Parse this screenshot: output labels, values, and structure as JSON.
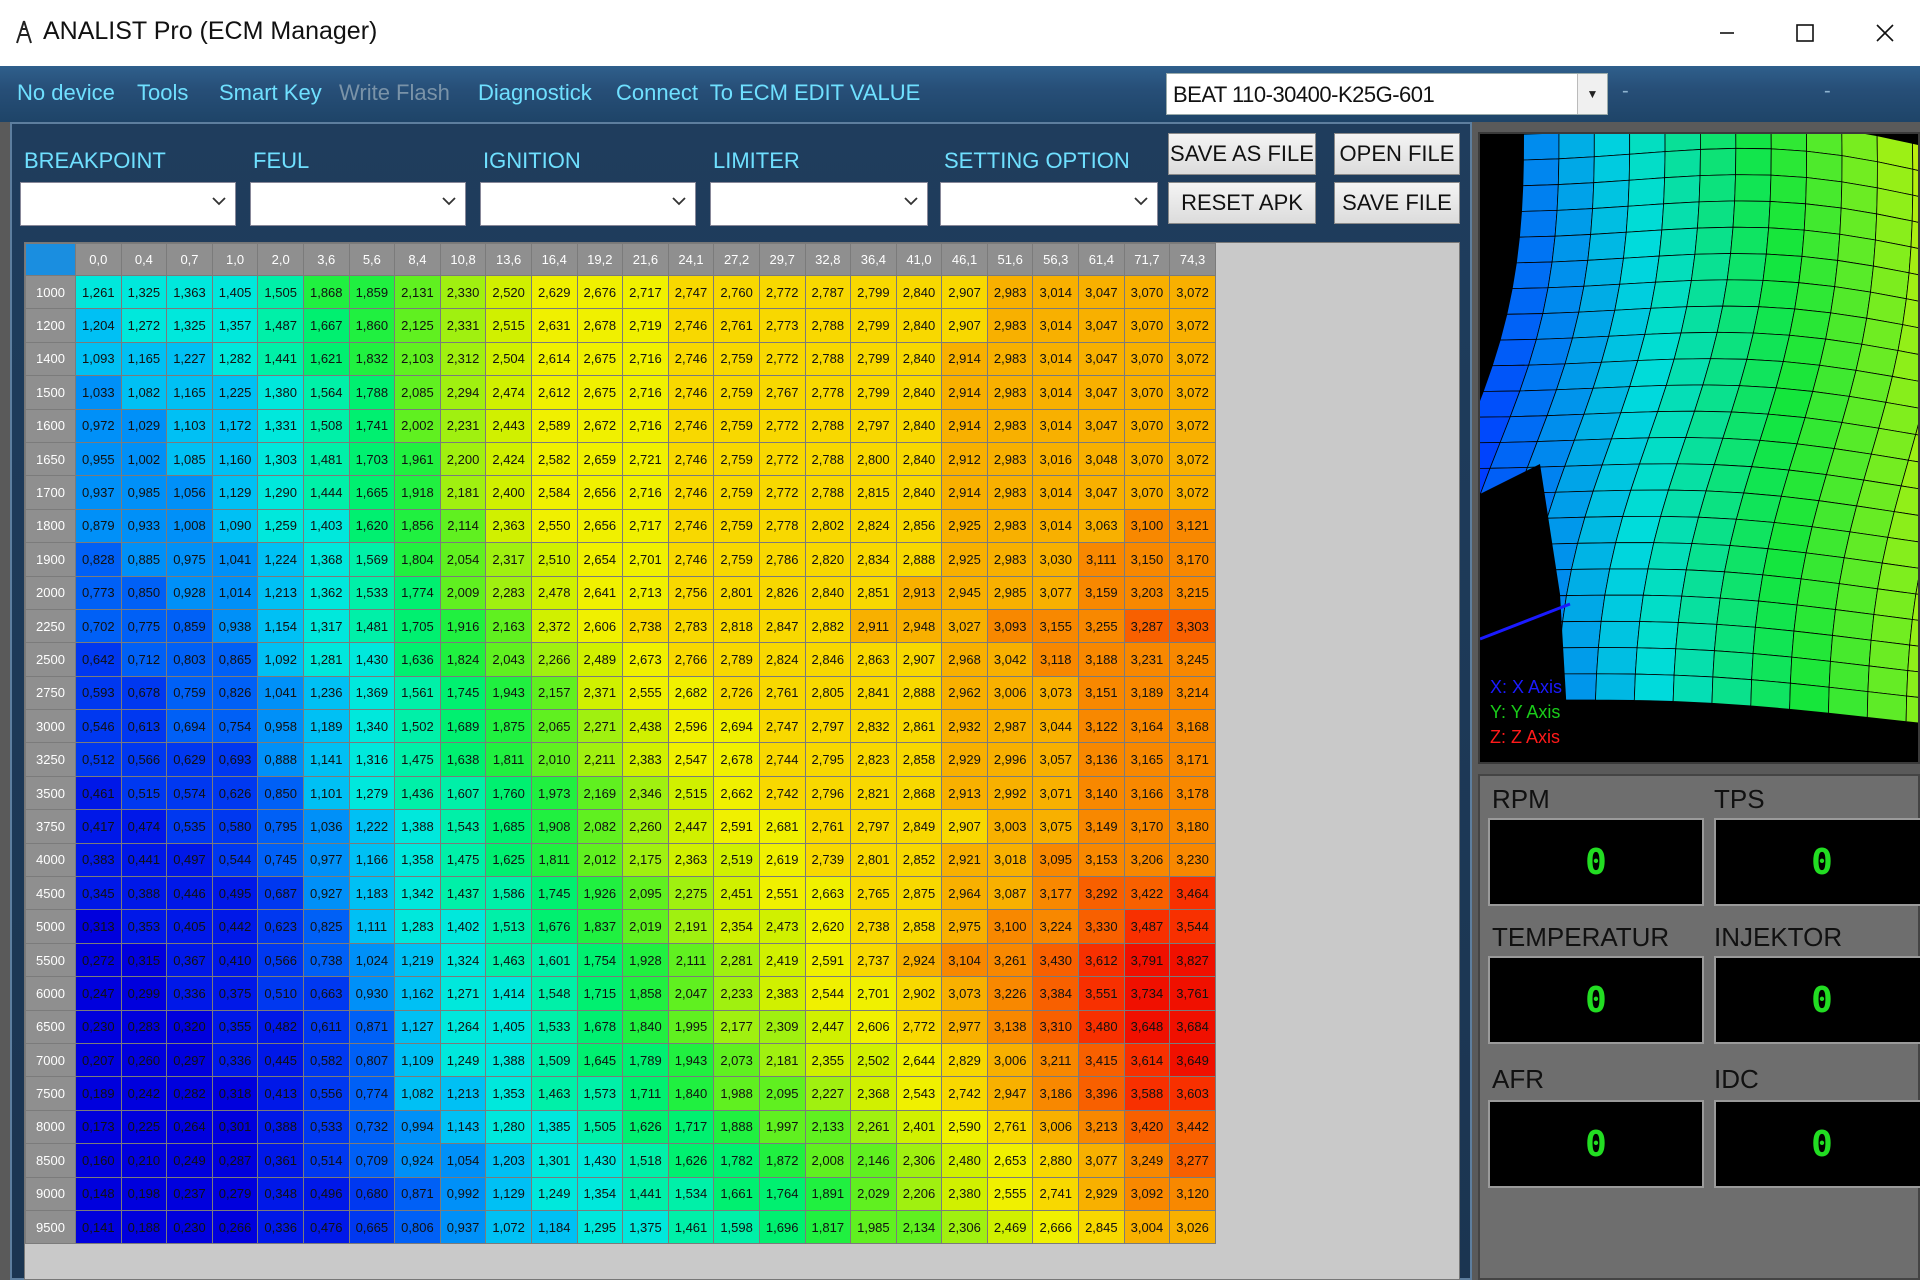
{
  "window": {
    "icon": "app-icon",
    "title": "ANALIST Pro (ECM Manager)"
  },
  "menu": {
    "items": [
      "No device",
      "Tools",
      "Smart Key",
      "Write Flash",
      "Diagnostick",
      "Connect  To ECM",
      "EDIT VALUE"
    ],
    "disabled": [
      "Write Flash"
    ],
    "device_select": "BEAT 110-30400-K25G-601",
    "dash1": "-",
    "dash2": "-"
  },
  "sections": [
    "BREAKPOINT",
    "FEUL",
    "IGNITION",
    "LIMITER",
    "SETTING OPTION"
  ],
  "buttons": {
    "save_as_file": "SAVE AS FILE",
    "open_file": "OPEN FILE",
    "reset_apk": "RESET APK",
    "save_file": "SAVE FILE"
  },
  "colors": {
    "menu_text": "#6fe0ff",
    "panel_bg": "#1f3d5d",
    "gauge_value": "#22dd22"
  },
  "table": {
    "columns": [
      "0,0",
      "0,4",
      "0,7",
      "1,0",
      "2,0",
      "3,6",
      "5,6",
      "8,4",
      "10,8",
      "13,6",
      "16,4",
      "19,2",
      "21,6",
      "24,1",
      "27,2",
      "29,7",
      "32,8",
      "36,4",
      "41,0",
      "46,1",
      "51,6",
      "56,3",
      "61,4",
      "71,7",
      "74,3"
    ],
    "rows": [
      {
        "rpm": "1000",
        "v": [
          "1,261",
          "1,325",
          "1,363",
          "1,405",
          "1,505",
          "1,868",
          "1,859",
          "2,131",
          "2,330",
          "2,520",
          "2,629",
          "2,676",
          "2,717",
          "2,747",
          "2,760",
          "2,772",
          "2,787",
          "2,799",
          "2,840",
          "2,907",
          "2,983",
          "3,014",
          "3,047",
          "3,070",
          "3,072"
        ]
      },
      {
        "rpm": "1200",
        "v": [
          "1,204",
          "1,272",
          "1,325",
          "1,357",
          "1,487",
          "1,667",
          "1,860",
          "2,125",
          "2,331",
          "2,515",
          "2,631",
          "2,678",
          "2,719",
          "2,746",
          "2,761",
          "2,773",
          "2,788",
          "2,799",
          "2,840",
          "2,907",
          "2,983",
          "3,014",
          "3,047",
          "3,070",
          "3,072"
        ]
      },
      {
        "rpm": "1400",
        "v": [
          "1,093",
          "1,165",
          "1,227",
          "1,282",
          "1,441",
          "1,621",
          "1,832",
          "2,103",
          "2,312",
          "2,504",
          "2,614",
          "2,675",
          "2,716",
          "2,746",
          "2,759",
          "2,772",
          "2,788",
          "2,799",
          "2,840",
          "2,914",
          "2,983",
          "3,014",
          "3,047",
          "3,070",
          "3,072"
        ]
      },
      {
        "rpm": "1500",
        "v": [
          "1,033",
          "1,082",
          "1,165",
          "1,225",
          "1,380",
          "1,564",
          "1,788",
          "2,085",
          "2,294",
          "2,474",
          "2,612",
          "2,675",
          "2,716",
          "2,746",
          "2,759",
          "2,767",
          "2,778",
          "2,799",
          "2,840",
          "2,914",
          "2,983",
          "3,014",
          "3,047",
          "3,070",
          "3,072"
        ]
      },
      {
        "rpm": "1600",
        "v": [
          "0,972",
          "1,029",
          "1,103",
          "1,172",
          "1,331",
          "1,508",
          "1,741",
          "2,002",
          "2,231",
          "2,443",
          "2,589",
          "2,672",
          "2,716",
          "2,746",
          "2,759",
          "2,772",
          "2,788",
          "2,797",
          "2,840",
          "2,914",
          "2,983",
          "3,014",
          "3,047",
          "3,070",
          "3,072"
        ]
      },
      {
        "rpm": "1650",
        "v": [
          "0,955",
          "1,002",
          "1,085",
          "1,160",
          "1,303",
          "1,481",
          "1,703",
          "1,961",
          "2,200",
          "2,424",
          "2,582",
          "2,659",
          "2,721",
          "2,746",
          "2,759",
          "2,772",
          "2,788",
          "2,800",
          "2,840",
          "2,912",
          "2,983",
          "3,016",
          "3,048",
          "3,070",
          "3,072"
        ]
      },
      {
        "rpm": "1700",
        "v": [
          "0,937",
          "0,985",
          "1,056",
          "1,129",
          "1,290",
          "1,444",
          "1,665",
          "1,918",
          "2,181",
          "2,400",
          "2,584",
          "2,656",
          "2,716",
          "2,746",
          "2,759",
          "2,772",
          "2,788",
          "2,815",
          "2,840",
          "2,914",
          "2,983",
          "3,014",
          "3,047",
          "3,070",
          "3,072"
        ]
      },
      {
        "rpm": "1800",
        "v": [
          "0,879",
          "0,933",
          "1,008",
          "1,090",
          "1,259",
          "1,403",
          "1,620",
          "1,856",
          "2,114",
          "2,363",
          "2,550",
          "2,656",
          "2,717",
          "2,746",
          "2,759",
          "2,778",
          "2,802",
          "2,824",
          "2,856",
          "2,925",
          "2,983",
          "3,014",
          "3,063",
          "3,100",
          "3,121"
        ]
      },
      {
        "rpm": "1900",
        "v": [
          "0,828",
          "0,885",
          "0,975",
          "1,041",
          "1,224",
          "1,368",
          "1,569",
          "1,804",
          "2,054",
          "2,317",
          "2,510",
          "2,654",
          "2,701",
          "2,746",
          "2,759",
          "2,786",
          "2,820",
          "2,834",
          "2,888",
          "2,925",
          "2,983",
          "3,030",
          "3,111",
          "3,150",
          "3,170"
        ]
      },
      {
        "rpm": "2000",
        "v": [
          "0,773",
          "0,850",
          "0,928",
          "1,014",
          "1,213",
          "1,362",
          "1,533",
          "1,774",
          "2,009",
          "2,283",
          "2,478",
          "2,641",
          "2,713",
          "2,756",
          "2,801",
          "2,826",
          "2,840",
          "2,851",
          "2,913",
          "2,945",
          "2,985",
          "3,077",
          "3,159",
          "3,203",
          "3,215"
        ]
      },
      {
        "rpm": "2250",
        "v": [
          "0,702",
          "0,775",
          "0,859",
          "0,938",
          "1,154",
          "1,317",
          "1,481",
          "1,705",
          "1,916",
          "2,163",
          "2,372",
          "2,606",
          "2,738",
          "2,783",
          "2,818",
          "2,847",
          "2,882",
          "2,911",
          "2,948",
          "3,027",
          "3,093",
          "3,155",
          "3,255",
          "3,287",
          "3,303"
        ]
      },
      {
        "rpm": "2500",
        "v": [
          "0,642",
          "0,712",
          "0,803",
          "0,865",
          "1,092",
          "1,281",
          "1,430",
          "1,636",
          "1,824",
          "2,043",
          "2,266",
          "2,489",
          "2,673",
          "2,766",
          "2,789",
          "2,824",
          "2,846",
          "2,863",
          "2,907",
          "2,968",
          "3,042",
          "3,118",
          "3,188",
          "3,231",
          "3,245"
        ]
      },
      {
        "rpm": "2750",
        "v": [
          "0,593",
          "0,678",
          "0,759",
          "0,826",
          "1,041",
          "1,236",
          "1,369",
          "1,561",
          "1,745",
          "1,943",
          "2,157",
          "2,371",
          "2,555",
          "2,682",
          "2,726",
          "2,761",
          "2,805",
          "2,841",
          "2,888",
          "2,962",
          "3,006",
          "3,073",
          "3,151",
          "3,189",
          "3,214"
        ]
      },
      {
        "rpm": "3000",
        "v": [
          "0,546",
          "0,613",
          "0,694",
          "0,754",
          "0,958",
          "1,189",
          "1,340",
          "1,502",
          "1,689",
          "1,875",
          "2,065",
          "2,271",
          "2,438",
          "2,596",
          "2,694",
          "2,747",
          "2,797",
          "2,832",
          "2,861",
          "2,932",
          "2,987",
          "3,044",
          "3,122",
          "3,164",
          "3,168"
        ]
      },
      {
        "rpm": "3250",
        "v": [
          "0,512",
          "0,566",
          "0,629",
          "0,693",
          "0,888",
          "1,141",
          "1,316",
          "1,475",
          "1,638",
          "1,811",
          "2,010",
          "2,211",
          "2,383",
          "2,547",
          "2,678",
          "2,744",
          "2,795",
          "2,823",
          "2,858",
          "2,929",
          "2,996",
          "3,057",
          "3,136",
          "3,165",
          "3,171"
        ]
      },
      {
        "rpm": "3500",
        "v": [
          "0,461",
          "0,515",
          "0,574",
          "0,626",
          "0,850",
          "1,101",
          "1,279",
          "1,436",
          "1,607",
          "1,760",
          "1,973",
          "2,169",
          "2,346",
          "2,515",
          "2,662",
          "2,742",
          "2,796",
          "2,821",
          "2,868",
          "2,913",
          "2,992",
          "3,071",
          "3,140",
          "3,166",
          "3,178"
        ]
      },
      {
        "rpm": "3750",
        "v": [
          "0,417",
          "0,474",
          "0,535",
          "0,580",
          "0,795",
          "1,036",
          "1,222",
          "1,388",
          "1,543",
          "1,685",
          "1,908",
          "2,082",
          "2,260",
          "2,447",
          "2,591",
          "2,681",
          "2,761",
          "2,797",
          "2,849",
          "2,907",
          "3,003",
          "3,075",
          "3,149",
          "3,170",
          "3,180"
        ]
      },
      {
        "rpm": "4000",
        "v": [
          "0,383",
          "0,441",
          "0,497",
          "0,544",
          "0,745",
          "0,977",
          "1,166",
          "1,358",
          "1,475",
          "1,625",
          "1,811",
          "2,012",
          "2,175",
          "2,363",
          "2,519",
          "2,619",
          "2,739",
          "2,801",
          "2,852",
          "2,921",
          "3,018",
          "3,095",
          "3,153",
          "3,206",
          "3,230"
        ]
      },
      {
        "rpm": "4500",
        "v": [
          "0,345",
          "0,388",
          "0,446",
          "0,495",
          "0,687",
          "0,927",
          "1,183",
          "1,342",
          "1,437",
          "1,586",
          "1,745",
          "1,926",
          "2,095",
          "2,275",
          "2,451",
          "2,551",
          "2,663",
          "2,765",
          "2,875",
          "2,964",
          "3,087",
          "3,177",
          "3,292",
          "3,422",
          "3,464"
        ]
      },
      {
        "rpm": "5000",
        "v": [
          "0,313",
          "0,353",
          "0,405",
          "0,442",
          "0,623",
          "0,825",
          "1,111",
          "1,283",
          "1,402",
          "1,513",
          "1,676",
          "1,837",
          "2,019",
          "2,191",
          "2,354",
          "2,473",
          "2,620",
          "2,738",
          "2,858",
          "2,975",
          "3,100",
          "3,224",
          "3,330",
          "3,487",
          "3,544"
        ]
      },
      {
        "rpm": "5500",
        "v": [
          "0,272",
          "0,315",
          "0,367",
          "0,410",
          "0,566",
          "0,738",
          "1,024",
          "1,219",
          "1,324",
          "1,463",
          "1,601",
          "1,754",
          "1,928",
          "2,111",
          "2,281",
          "2,419",
          "2,591",
          "2,737",
          "2,924",
          "3,104",
          "3,261",
          "3,430",
          "3,612",
          "3,791",
          "3,827"
        ]
      },
      {
        "rpm": "6000",
        "v": [
          "0,247",
          "0,299",
          "0,336",
          "0,375",
          "0,510",
          "0,663",
          "0,930",
          "1,162",
          "1,271",
          "1,414",
          "1,548",
          "1,715",
          "1,858",
          "2,047",
          "2,233",
          "2,383",
          "2,544",
          "2,701",
          "2,902",
          "3,073",
          "3,226",
          "3,384",
          "3,551",
          "3,734",
          "3,761"
        ]
      },
      {
        "rpm": "6500",
        "v": [
          "0,230",
          "0,283",
          "0,320",
          "0,355",
          "0,482",
          "0,611",
          "0,871",
          "1,127",
          "1,264",
          "1,405",
          "1,533",
          "1,678",
          "1,840",
          "1,995",
          "2,177",
          "2,309",
          "2,447",
          "2,606",
          "2,772",
          "2,977",
          "3,138",
          "3,310",
          "3,480",
          "3,648",
          "3,684"
        ]
      },
      {
        "rpm": "7000",
        "v": [
          "0,207",
          "0,260",
          "0,297",
          "0,336",
          "0,445",
          "0,582",
          "0,807",
          "1,109",
          "1,249",
          "1,388",
          "1,509",
          "1,645",
          "1,789",
          "1,943",
          "2,073",
          "2,181",
          "2,355",
          "2,502",
          "2,644",
          "2,829",
          "3,006",
          "3,211",
          "3,415",
          "3,614",
          "3,649"
        ]
      },
      {
        "rpm": "7500",
        "v": [
          "0,189",
          "0,242",
          "0,282",
          "0,318",
          "0,413",
          "0,556",
          "0,774",
          "1,082",
          "1,213",
          "1,353",
          "1,463",
          "1,573",
          "1,711",
          "1,840",
          "1,988",
          "2,095",
          "2,227",
          "2,368",
          "2,543",
          "2,742",
          "2,947",
          "3,186",
          "3,396",
          "3,588",
          "3,603"
        ]
      },
      {
        "rpm": "8000",
        "v": [
          "0,173",
          "0,225",
          "0,264",
          "0,301",
          "0,388",
          "0,533",
          "0,732",
          "0,994",
          "1,143",
          "1,280",
          "1,385",
          "1,505",
          "1,626",
          "1,717",
          "1,888",
          "1,997",
          "2,133",
          "2,261",
          "2,401",
          "2,590",
          "2,761",
          "3,006",
          "3,213",
          "3,420",
          "3,442"
        ]
      },
      {
        "rpm": "8500",
        "v": [
          "0,160",
          "0,210",
          "0,249",
          "0,287",
          "0,361",
          "0,514",
          "0,709",
          "0,924",
          "1,054",
          "1,203",
          "1,301",
          "1,430",
          "1,518",
          "1,626",
          "1,782",
          "1,872",
          "2,008",
          "2,146",
          "2,306",
          "2,480",
          "2,653",
          "2,880",
          "3,077",
          "3,249",
          "3,277"
        ]
      },
      {
        "rpm": "9000",
        "v": [
          "0,148",
          "0,198",
          "0,237",
          "0,279",
          "0,348",
          "0,496",
          "0,680",
          "0,871",
          "0,992",
          "1,129",
          "1,249",
          "1,354",
          "1,441",
          "1,534",
          "1,661",
          "1,764",
          "1,891",
          "2,029",
          "2,206",
          "2,380",
          "2,555",
          "2,741",
          "2,929",
          "3,092",
          "3,120"
        ]
      },
      {
        "rpm": "9500",
        "v": [
          "0,141",
          "0,188",
          "0,230",
          "0,266",
          "0,336",
          "0,476",
          "0,665",
          "0,806",
          "0,937",
          "1,072",
          "1,184",
          "1,295",
          "1,375",
          "1,461",
          "1,598",
          "1,696",
          "1,817",
          "1,985",
          "2,134",
          "2,306",
          "2,469",
          "2,666",
          "2,845",
          "3,004",
          "3,026"
        ]
      }
    ],
    "colors": [
      "#0000dd",
      "#0018e8",
      "#0038f0",
      "#0060f6",
      "#0090f8",
      "#00c0f4",
      "#00e8dc",
      "#00f0a8",
      "#00f070",
      "#20f040",
      "#60f020",
      "#a0f010",
      "#d0f000",
      "#f0f000",
      "#f8d800",
      "#f8b000",
      "#f88800",
      "#f86000",
      "#f83000",
      "#f01000"
    ],
    "value_range": [
      0.14,
      3.83
    ]
  },
  "view3d": {
    "axis_legend": [
      "X: X Axis",
      "Y: Y Axis",
      "Z: Z Axis"
    ],
    "axis_colors": [
      "#1a1aff",
      "#1acc1a",
      "#ff1a1a"
    ]
  },
  "gauges": [
    {
      "label": "RPM",
      "value": "0"
    },
    {
      "label": "TPS",
      "value": "0"
    },
    {
      "label": "TEMPERATUR",
      "value": "0"
    },
    {
      "label": "INJEKTOR",
      "value": "0"
    },
    {
      "label": "AFR",
      "value": "0"
    },
    {
      "label": "IDC",
      "value": "0"
    }
  ]
}
